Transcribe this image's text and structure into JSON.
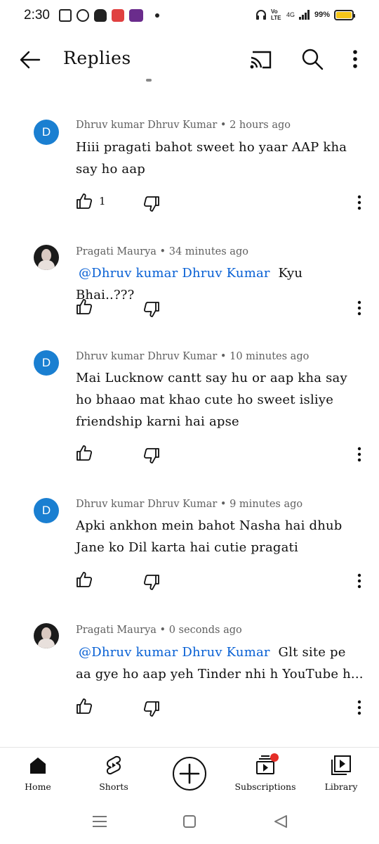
{
  "status_bar": {
    "time": "2:30",
    "network_label": "Vo LTE",
    "signal_label": "4G",
    "battery_percent": "99%",
    "battery_level": 0.99,
    "battery_color": "#f5c518"
  },
  "app_bar": {
    "title": "Replies",
    "icons": [
      "back-arrow-icon",
      "cast-icon",
      "search-icon",
      "more-vertical-icon"
    ]
  },
  "comments": [
    {
      "avatar_letter": "D",
      "avatar_color": "#1a7fd1",
      "author": "Dhruv kumar Dhruv Kumar",
      "separator": "•",
      "time": "2 hours ago",
      "mention": "",
      "text": "Hiii pragati bahot sweet ho yaar AAP kha say ho aap",
      "likes": "1"
    },
    {
      "avatar_letter": "",
      "avatar_color": "#1b1b1b",
      "author": "Pragati Maurya",
      "separator": "•",
      "time": "34 minutes ago",
      "mention": "@Dhruv kumar Dhruv Kumar",
      "text": "Kyu Bhai..???",
      "likes": ""
    },
    {
      "avatar_letter": "D",
      "avatar_color": "#1a7fd1",
      "author": "Dhruv kumar Dhruv Kumar",
      "separator": "•",
      "time": "10 minutes ago",
      "mention": "",
      "text": "Mai Lucknow cantt say hu or aap kha say ho bhaao mat khao cute ho sweet isliye friendship karni hai apse",
      "likes": ""
    },
    {
      "avatar_letter": "D",
      "avatar_color": "#1a7fd1",
      "author": "Dhruv kumar Dhruv Kumar",
      "separator": "•",
      "time": "9 minutes ago",
      "mention": "",
      "text": "Apki ankhon mein bahot Nasha hai dhub Jane ko Dil karta hai cutie pragati",
      "likes": ""
    },
    {
      "avatar_letter": "",
      "avatar_color": "#1b1b1b",
      "author": "Pragati Maurya",
      "separator": "•",
      "time": "0 seconds ago",
      "mention": "@Dhruv kumar Dhruv Kumar",
      "text": "Glt site pe aa gye ho aap yeh Tinder nhi h YouTube h...",
      "likes": ""
    }
  ],
  "bottom_nav": {
    "home": "Home",
    "shorts": "Shorts",
    "subscriptions": "Subscriptions",
    "library": "Library",
    "accent_color": "#e52d27"
  }
}
